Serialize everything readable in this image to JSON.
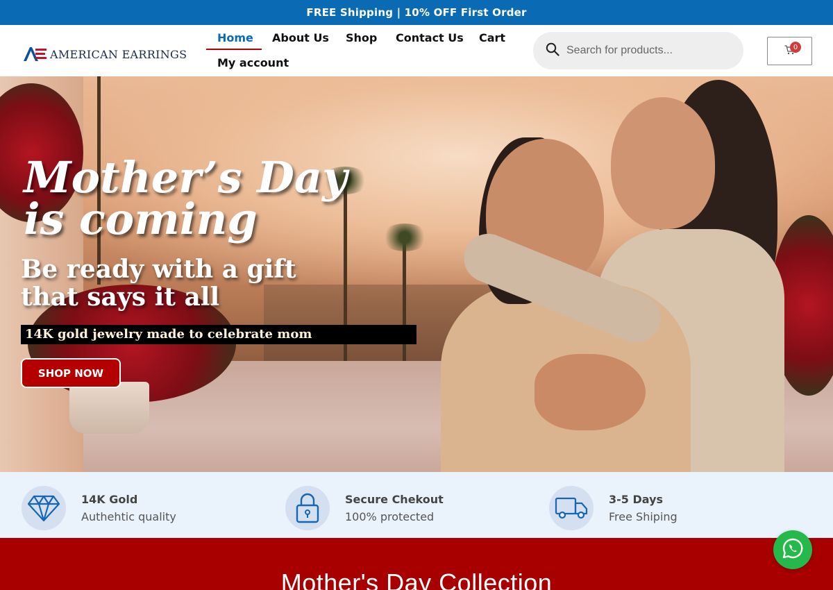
{
  "promo": {
    "text": "FREE Shipping | 10% OFF First Order"
  },
  "header": {
    "logo_text": "AMERICAN EARRINGS",
    "nav": [
      {
        "label": "Home",
        "active": true
      },
      {
        "label": "About Us"
      },
      {
        "label": "Shop"
      },
      {
        "label": "Contact Us"
      },
      {
        "label": "Cart"
      },
      {
        "label": "My account"
      }
    ],
    "search": {
      "placeholder": "Search for products..."
    },
    "cart": {
      "count": "0"
    }
  },
  "hero": {
    "title": "Mother’s Day\nis coming",
    "subtitle": "Be ready with a gift\nthat says it all",
    "tagline": "14K gold jewelry made to celebrate mom",
    "cta": "SHOP NOW"
  },
  "features": [
    {
      "icon": "diamond-icon",
      "title": "14K Gold",
      "subtitle": "Authehtic quality"
    },
    {
      "icon": "lock-icon",
      "title": "Secure Chekout",
      "subtitle": "100% protected"
    },
    {
      "icon": "truck-icon",
      "title": "3-5 Days",
      "subtitle": "Free Shiping"
    }
  ],
  "collection": {
    "title": "Mother's Day Collection"
  },
  "colors": {
    "brand_blue": "#0a6ab4",
    "brand_red": "#b40000",
    "collection_red": "#a80000",
    "whatsapp_green": "#25b84a"
  }
}
